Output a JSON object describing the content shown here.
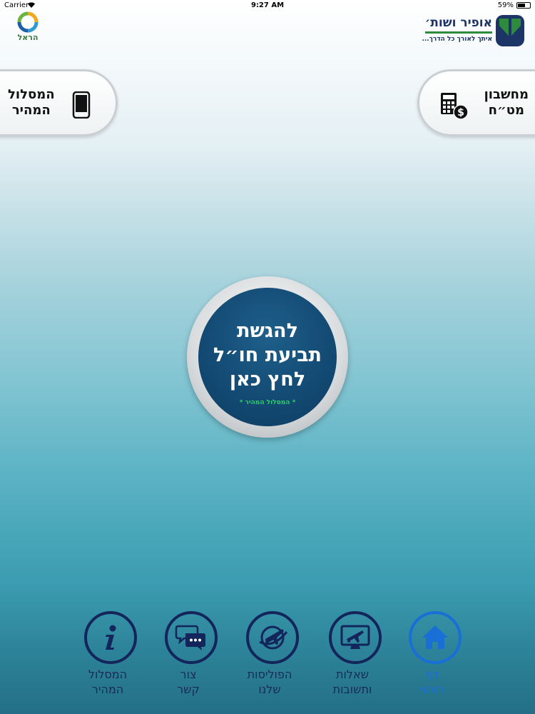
{
  "status_bar": {
    "carrier": "Carrier",
    "time": "9:27 AM",
    "battery": "59%"
  },
  "harel_logo": {
    "text": "הראל"
  },
  "ofir_logo": {
    "name": "אופיר ושות׳",
    "slogan": "איתך לאורך כל הדרך..."
  },
  "side_buttons": {
    "left": {
      "line1": "המסלול",
      "line2": "המהיר",
      "icon": "phone-icon"
    },
    "right": {
      "line1": "מחשבון",
      "line2": "מט״ח",
      "icon": "calculator-dollar-icon"
    }
  },
  "main_button": {
    "line1": "להגשת",
    "line2": "תביעת חו״ל",
    "line3": "לחץ כאן",
    "sub": "* המסלול המהיר *"
  },
  "bottom_nav": [
    {
      "line1": "דף",
      "line2": "ראשי",
      "icon": "home-icon",
      "active": true
    },
    {
      "line1": "שאלות",
      "line2": "ותשובות",
      "icon": "monitor-plane-icon",
      "active": false
    },
    {
      "line1": "הפוליסות",
      "line2": "שלנו",
      "icon": "globe-plane-icon",
      "active": false
    },
    {
      "line1": "צור",
      "line2": "קשר",
      "icon": "chat-bubbles-icon",
      "active": false
    },
    {
      "line1": "המסלול",
      "line2": "המהיר",
      "icon": "info-icon",
      "active": false
    }
  ],
  "colors": {
    "navy": "#13255a",
    "active_blue": "#1a6fd6",
    "circle_blue": "#124972",
    "green": "#2fd16a"
  }
}
